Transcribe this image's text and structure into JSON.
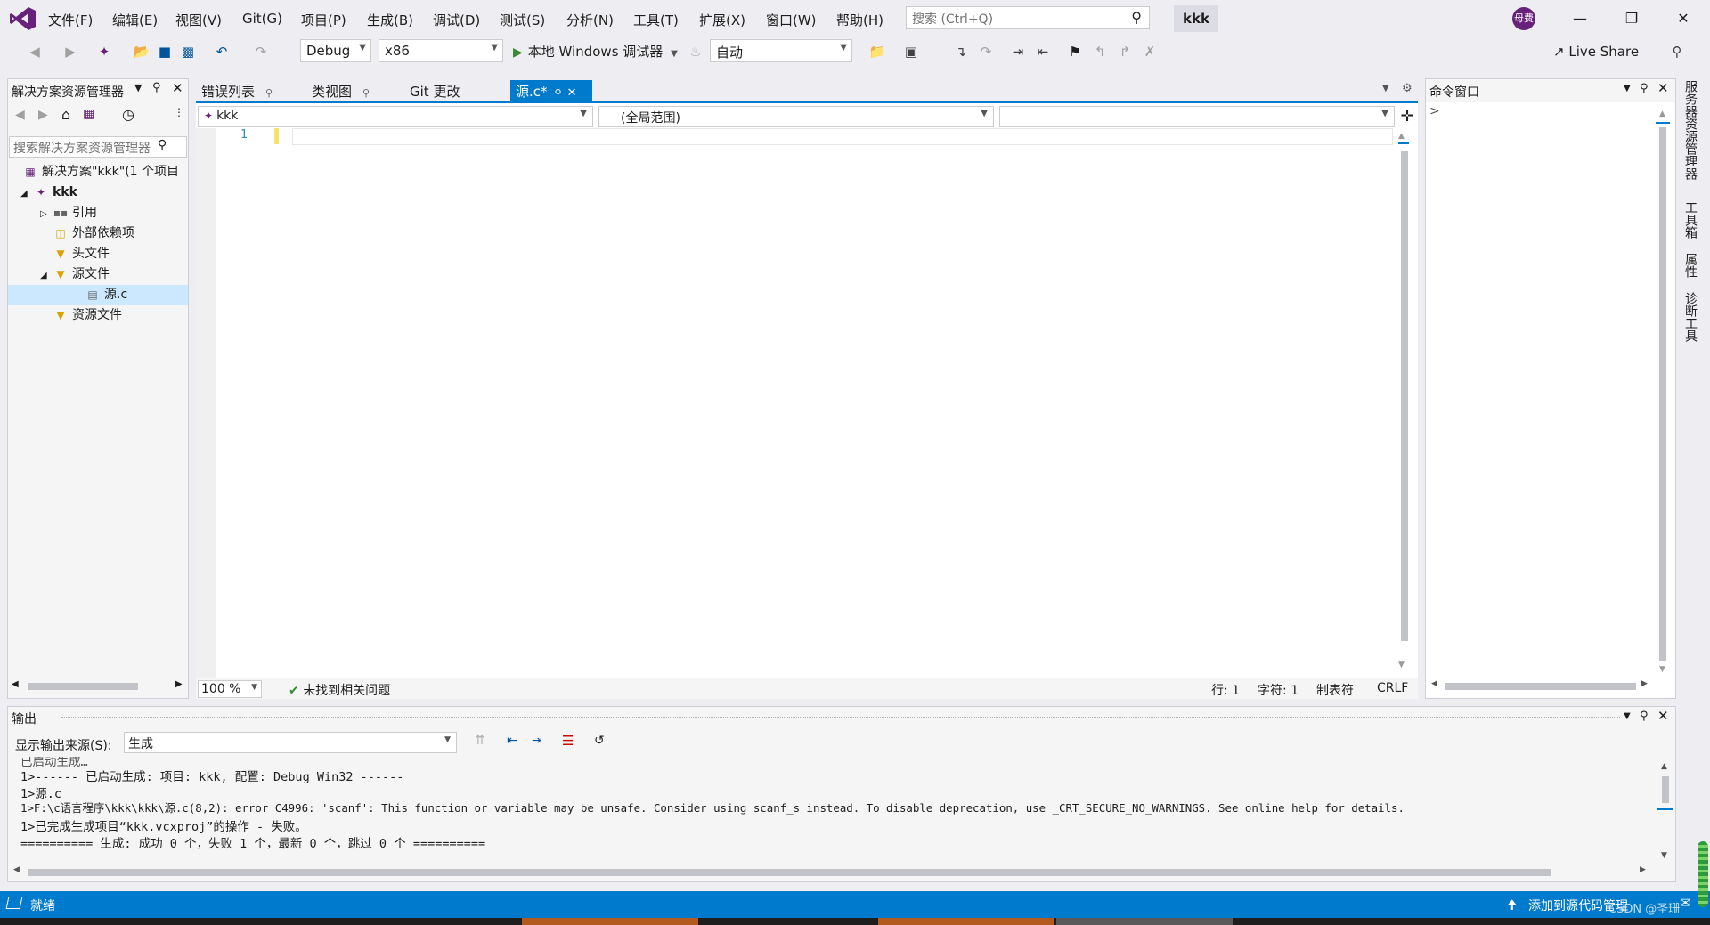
{
  "menu": {
    "items": [
      "文件(F)",
      "编辑(E)",
      "视图(V)",
      "Git(G)",
      "项目(P)",
      "生成(B)",
      "调试(D)",
      "测试(S)",
      "分析(N)",
      "工具(T)",
      "扩展(X)",
      "窗口(W)",
      "帮助(H)"
    ],
    "search_placeholder": "搜索 (Ctrl+Q)",
    "solution_name": "kkk",
    "avatar_text": "母费"
  },
  "toolbar": {
    "config": "Debug",
    "platform": "x86",
    "run_label": "本地 Windows 调试器",
    "mode": "自动",
    "live_share": "Live Share"
  },
  "solution_explorer": {
    "title": "解决方案资源管理器",
    "search_placeholder": "搜索解决方案资源管理器",
    "tree": [
      {
        "label": "解决方案\"kkk\"(1 个项目",
        "level": 0,
        "icon": "solution-icon"
      },
      {
        "label": "kkk",
        "level": 0,
        "icon": "project-icon",
        "bold": true
      },
      {
        "label": "引用",
        "level": 1,
        "icon": "references-icon"
      },
      {
        "label": "外部依赖项",
        "level": 1,
        "icon": "external-deps-icon"
      },
      {
        "label": "头文件",
        "level": 1,
        "icon": "filter-folder-icon"
      },
      {
        "label": "源文件",
        "level": 1,
        "icon": "filter-folder-icon"
      },
      {
        "label": "源.c",
        "level": 2,
        "icon": "c-file-icon",
        "selected": true
      },
      {
        "label": "资源文件",
        "level": 1,
        "icon": "filter-folder-icon"
      }
    ]
  },
  "editor": {
    "tabs": [
      "错误列表",
      "类视图",
      "Git 更改",
      "源.c*"
    ],
    "nav_project": "kkk",
    "nav_scope": "(全局范围)",
    "line_number": "1",
    "zoom": "100 %",
    "issues": "未找到相关问题",
    "line": "行: 1",
    "char": "字符: 1",
    "tabs_mode": "制表符",
    "eol": "CRLF"
  },
  "command_window": {
    "title": "命令窗口",
    "prompt": ">"
  },
  "side_tabs": [
    "服务器资源管理器",
    "工具箱",
    "属性",
    "诊断工具"
  ],
  "output": {
    "title": "输出",
    "source_label": "显示输出来源(S):",
    "source_value": "生成",
    "lines": [
      "已启动生成…",
      "1>------ 已启动生成: 项目: kkk, 配置: Debug Win32 ------",
      "1>源.c",
      "1>F:\\c语言程序\\kkk\\kkk\\源.c(8,2): error C4996: 'scanf': This function or variable may be unsafe. Consider using scanf_s instead. To disable deprecation, use _CRT_SECURE_NO_WARNINGS. See online help for details.",
      "1>已完成生成项目“kkk.vcxproj”的操作 - 失败。",
      "========== 生成: 成功 0 个，失败 1 个，最新 0 个，跳过 0 个 =========="
    ]
  },
  "statusbar": {
    "ready": "就绪",
    "source_control": "添加到源代码管理",
    "watermark": "CSDN @圣珊"
  },
  "colors": {
    "accent": "#007acc",
    "vs_purple": "#68217a",
    "run_green": "#388a34"
  }
}
